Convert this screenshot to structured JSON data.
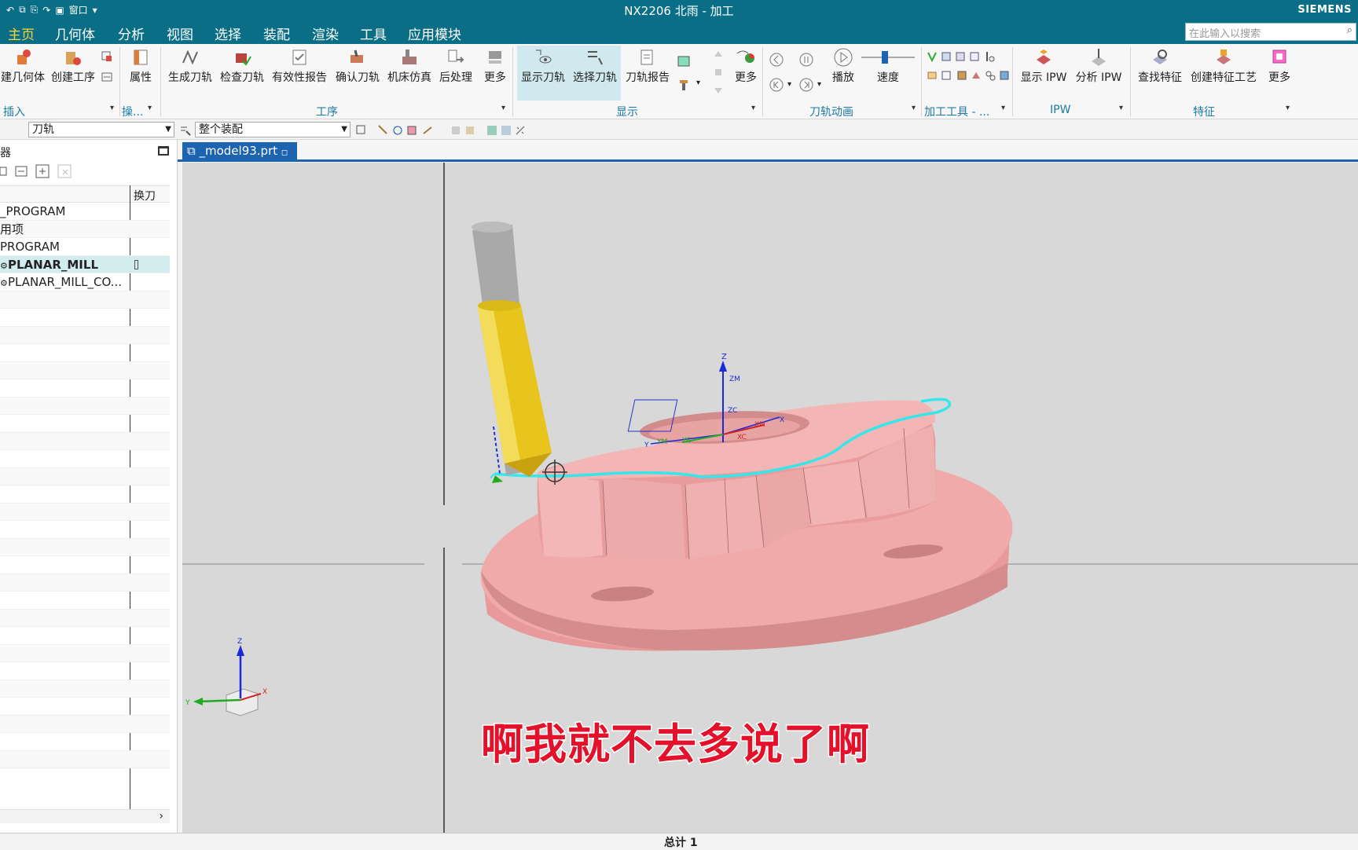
{
  "window": {
    "title": "NX2206 北雨 - 加工",
    "brand": "SIEMENS",
    "quick_access_window": "窗口"
  },
  "menu": {
    "items": [
      "主页",
      "几何体",
      "分析",
      "视图",
      "选择",
      "装配",
      "渲染",
      "工具",
      "应用模块"
    ],
    "active": "主页",
    "search_placeholder": "在此输入以搜索"
  },
  "ribbon": {
    "insert_buttons": [
      "建几何体",
      "创建工序"
    ],
    "properties_button": "属性",
    "operation_buttons": [
      "生成刀轨",
      "检查刀轨",
      "有效性报告",
      "确认刀轨",
      "机床仿真",
      "后处理",
      "更多"
    ],
    "display_buttons": [
      "显示刀轨",
      "选择刀轨",
      "刀轨报告",
      "更多"
    ],
    "animation_buttons": [
      "播放",
      "速度"
    ],
    "ipw_buttons": [
      "显示 IPW",
      "分析 IPW"
    ],
    "feature_buttons": [
      "查找特征",
      "创建特征工艺",
      "更多"
    ],
    "groups": [
      "插入",
      "操...",
      "工序",
      "显示",
      "刀轨动画",
      "加工工具 - ...",
      "IPW",
      "特征"
    ]
  },
  "selection_bar": {
    "filter": "刀轨",
    "scope": "整个装配"
  },
  "navigator": {
    "title": "器",
    "column_2": "换刀",
    "rows": [
      {
        "name": "_PROGRAM",
        "selected": false
      },
      {
        "name": "用项",
        "selected": false
      },
      {
        "name": "PROGRAM",
        "selected": false
      },
      {
        "name": "PLANAR_MILL",
        "selected": true
      },
      {
        "name": "PLANAR_MILL_CO...",
        "selected": false
      }
    ],
    "empty_rows": 27
  },
  "tab": {
    "label": "_model93.prt"
  },
  "viewport": {
    "subtitle": "啊我就不去多说了啊",
    "axis_labels": {
      "z": "Z",
      "y": "Y",
      "x": "X",
      "zm": "ZM",
      "xm": "XM",
      "ym": "YM",
      "zc": "ZC",
      "xc": "XC",
      "yc": "YC"
    },
    "colors": {
      "part": "#f0a9a9",
      "toolpath": "#35e6ea",
      "tool_body": "#e8c51d",
      "tool_shank": "#a9a9a9"
    }
  },
  "status": {
    "text": "总计 1"
  }
}
